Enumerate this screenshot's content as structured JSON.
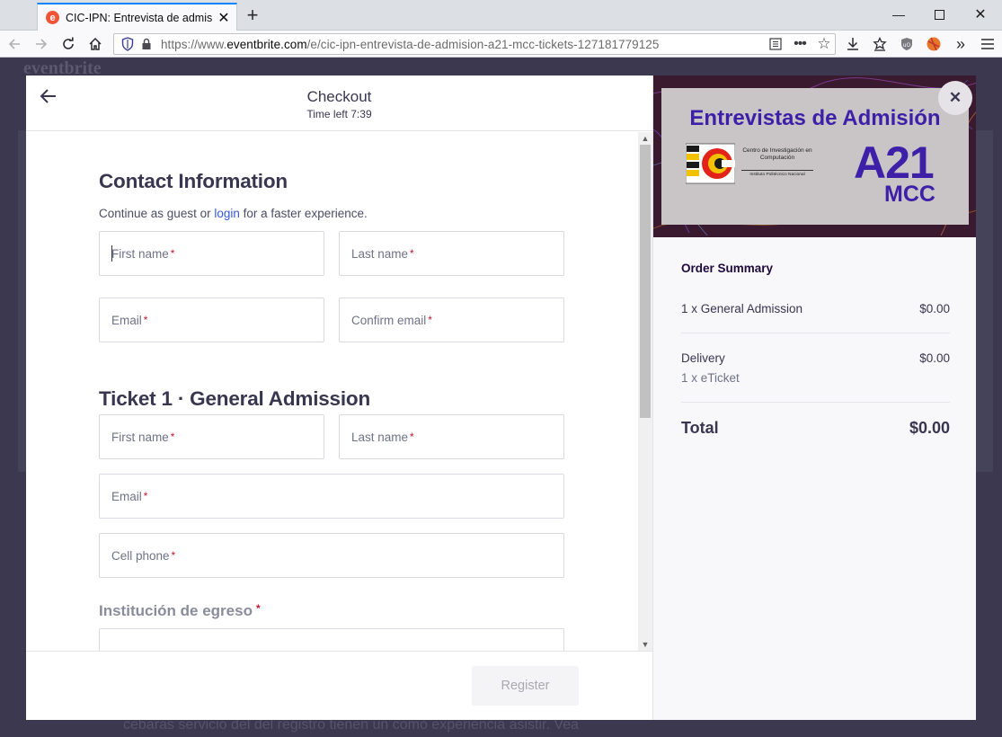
{
  "browser": {
    "tab_title": "CIC-IPN: Entrevista de admisión",
    "url_scheme": "https://www.",
    "url_domain": "eventbrite.com",
    "url_path": "/e/cic-ipn-entrevista-de-admision-a21-mcc-tickets-127181779125",
    "favicon_letter": "e"
  },
  "background": {
    "logo": "eventbrite",
    "footer_text": "cebaras servicio del del registro tienen un como experiencia asistir. Vea"
  },
  "checkout": {
    "title": "Checkout",
    "timer": "Time left 7:39",
    "contact_heading": "Contact Information",
    "contact_sub_prefix": "Continue as guest or",
    "contact_sub_link": "login",
    "contact_sub_suffix": "for a faster experience.",
    "contact_fields": {
      "first_name": "First name",
      "last_name": "Last name",
      "email": "Email",
      "confirm_email": "Confirm email"
    },
    "ticket_heading": "Ticket 1 · General Admission",
    "ticket_fields": {
      "first_name": "First name",
      "last_name": "Last name",
      "email": "Email",
      "cell_phone": "Cell phone"
    },
    "institution_label": "Institución de egreso",
    "required_mark": "*",
    "register_button": "Register"
  },
  "hero": {
    "title": "Entrevistas de Admisión",
    "big_text": "A21",
    "program": "MCC",
    "org_line1": "Centro de Investigación en Computación",
    "org_line2": "Instituto Politécnico Nacional"
  },
  "order_summary": {
    "title": "Order Summary",
    "items": [
      {
        "label": "1 x General Admission",
        "price": "$0.00"
      }
    ],
    "delivery_label": "Delivery",
    "delivery_price": "$0.00",
    "delivery_detail": "1 x eTicket",
    "total_label": "Total",
    "total_price": "$0.00"
  },
  "colors": {
    "accent_link": "#3659e3",
    "required": "#c5162e",
    "hero_text": "#3d1fa8",
    "brand_orange": "#f05537"
  }
}
